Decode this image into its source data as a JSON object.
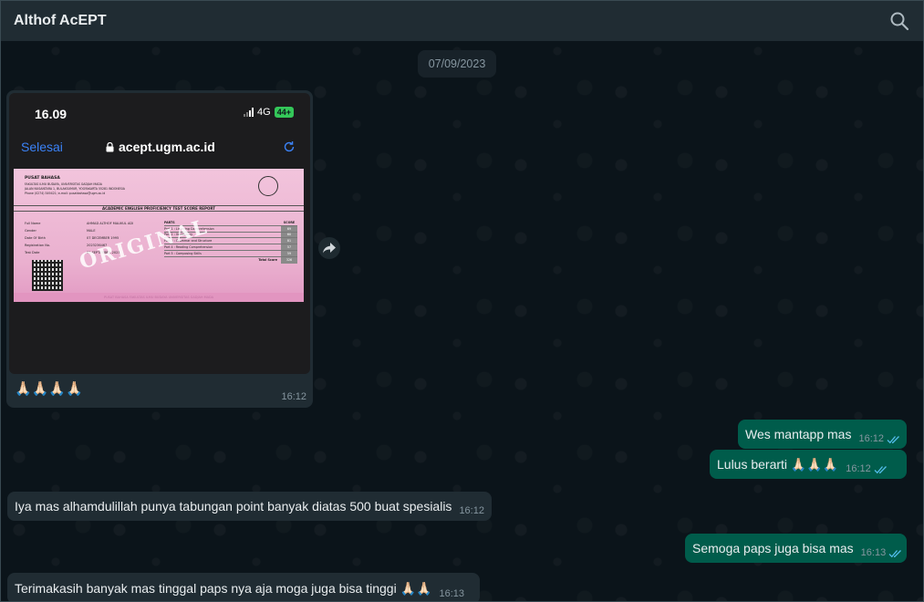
{
  "header": {
    "title": "Althof AcEPT",
    "search_icon": "search-icon"
  },
  "date_chip": "07/09/2023",
  "image_message": {
    "phone": {
      "time": "16.09",
      "network": "4G",
      "battery": "44+",
      "done_label": "Selesai",
      "url": "acept.ugm.ac.id"
    },
    "certificate": {
      "org": "PUSAT BAHASA",
      "org_lines": [
        "FAKULTAS ILMU BUDAYA, UNIVERSITAS GADJAH MADA",
        "JALAN NUSANTARA 1, BULAKSUMUR, YOGYAKARTA 55281 INDONESIA",
        "Phone (0274) 549421; e-mail: pusatbahasa@ugm.ac.id"
      ],
      "report_title": "ACADEMIC ENGLISH PROFICIENCY TEST SCORE REPORT",
      "fields": [
        {
          "label": "Full Name",
          "value": "AHMAD ALTHOF MALIKUL ADI"
        },
        {
          "label": "Gender",
          "value": "MALE"
        },
        {
          "label": "Date Of Birth",
          "value": "07 DECEMBER 1995"
        },
        {
          "label": "Registration No.",
          "value": "2023236467"
        },
        {
          "label": "Test Date",
          "value": "05 SEPTEMBER 2023"
        }
      ],
      "stamp": "ORIGINAL",
      "table_head": {
        "parts": "PARTS",
        "score": "SCORE"
      },
      "scores": [
        {
          "part": "Part 1 : Listening Comprehension",
          "score": "69"
        },
        {
          "part": "Part 2 : Vocabulary",
          "score": "60"
        },
        {
          "part": "Part 3 : Grammar and Structure",
          "score": "81"
        },
        {
          "part": "Part 4 : Reading Comprehension",
          "score": "57"
        },
        {
          "part": "Part 5 : Composing Skills",
          "score": "59"
        }
      ],
      "total_label": "Total Score",
      "total": "326",
      "footer": "PUSAT BAHASA FAKULTAS ILMU BUDAYA UNIVERSITAS GADJAH MADA"
    },
    "caption": "🙏🏻🙏🏻🙏🏻🙏🏻",
    "time": "16:12"
  },
  "messages": [
    {
      "dir": "out",
      "text": "Wes mantapp mas",
      "time": "16:12"
    },
    {
      "dir": "out",
      "text": "Lulus berarti 🙏🏻🙏🏻🙏🏻",
      "time": "16:12"
    },
    {
      "dir": "in",
      "text": "Iya mas alhamdulillah punya tabungan point banyak diatas 500 buat spesialis",
      "time": "16:12"
    },
    {
      "dir": "out",
      "text": "Semoga paps juga bisa mas",
      "time": "16:13"
    },
    {
      "dir": "in",
      "text": "Terimakasih banyak mas tinggal paps nya aja moga juga bisa tinggi 🙏🏻🙏🏻",
      "time": "16:13"
    }
  ],
  "colors": {
    "bubble_out": "#005c4b",
    "bubble_in": "#202c33",
    "tick": "#53bdeb"
  }
}
